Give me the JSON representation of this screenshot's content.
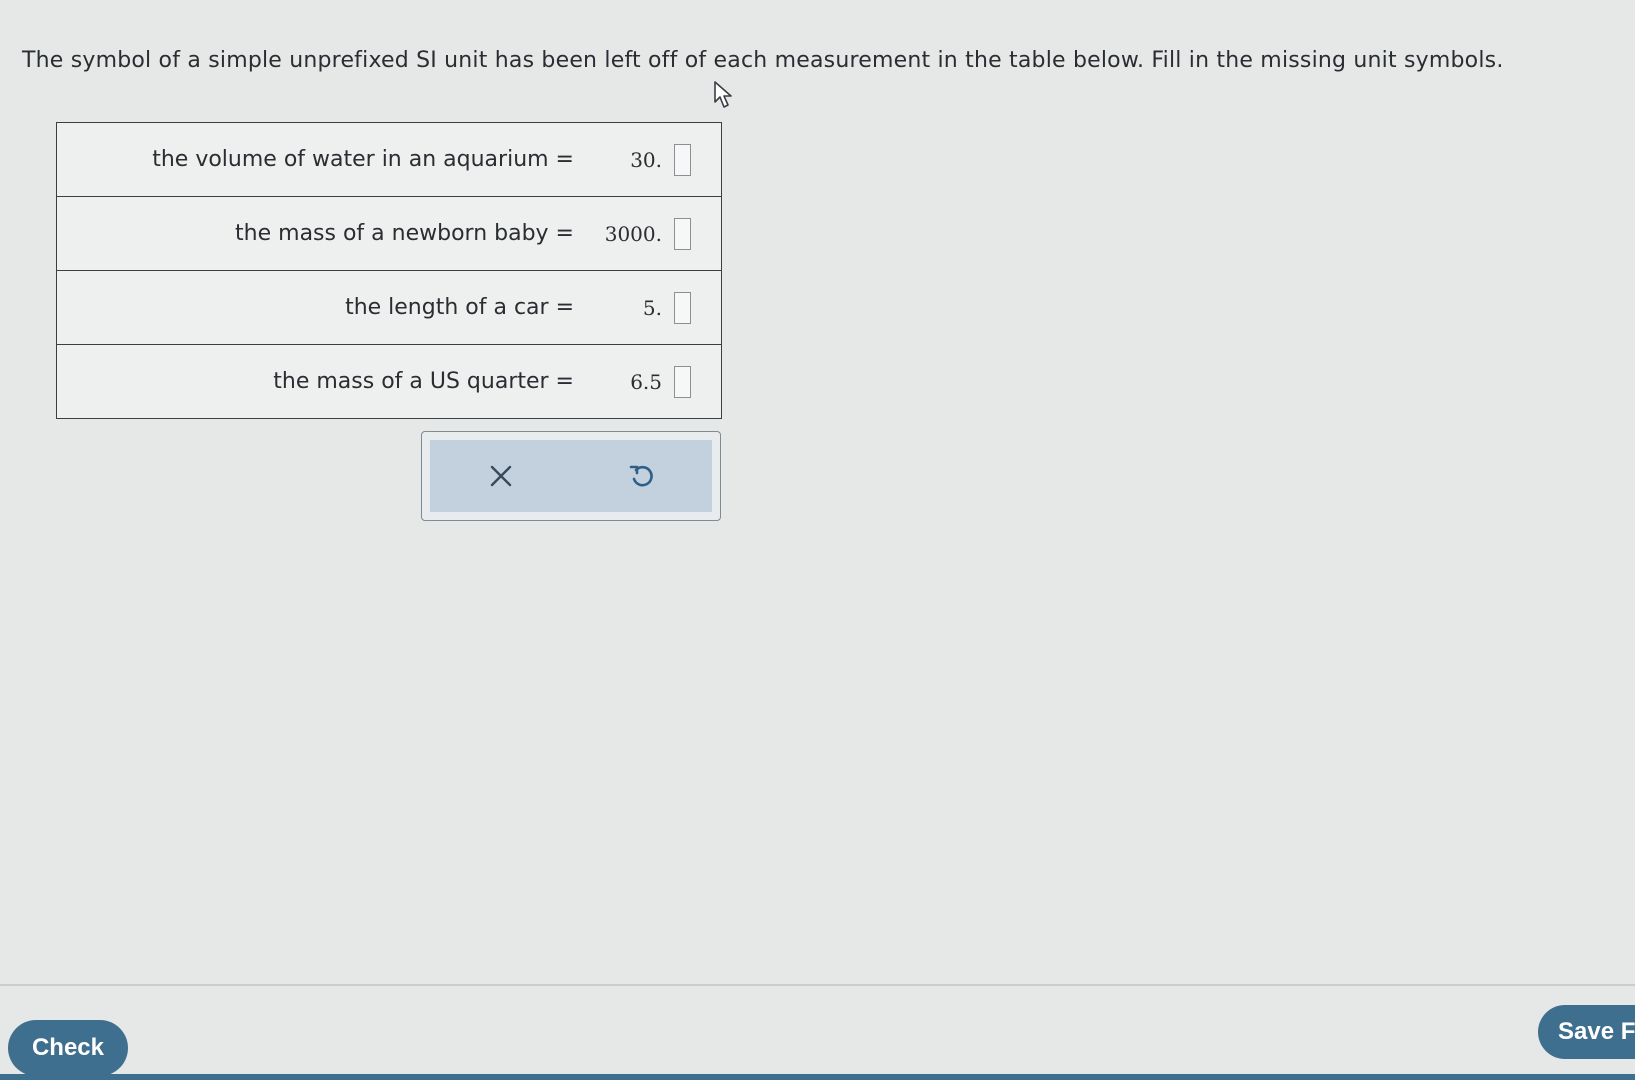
{
  "question": {
    "prompt": "The symbol of a simple unprefixed SI unit has been left off of each measurement in the table below. Fill in the missing unit symbols."
  },
  "table": {
    "rows": [
      {
        "label": "the volume of water in an aquarium =",
        "value": "30.",
        "unit": ""
      },
      {
        "label": "the mass of a newborn baby =",
        "value": "3000.",
        "unit": ""
      },
      {
        "label": "the length of a car =",
        "value": "5.",
        "unit": ""
      },
      {
        "label": "the mass of a US quarter =",
        "value": "6.5",
        "unit": ""
      }
    ]
  },
  "toolbar": {
    "clear_icon": "x-icon",
    "undo_icon": "undo-icon"
  },
  "footer": {
    "check_label": "Check",
    "save_label": "Save F"
  },
  "colors": {
    "accent": "#3f6f8f",
    "toolbar_bg": "#c3d1de"
  }
}
